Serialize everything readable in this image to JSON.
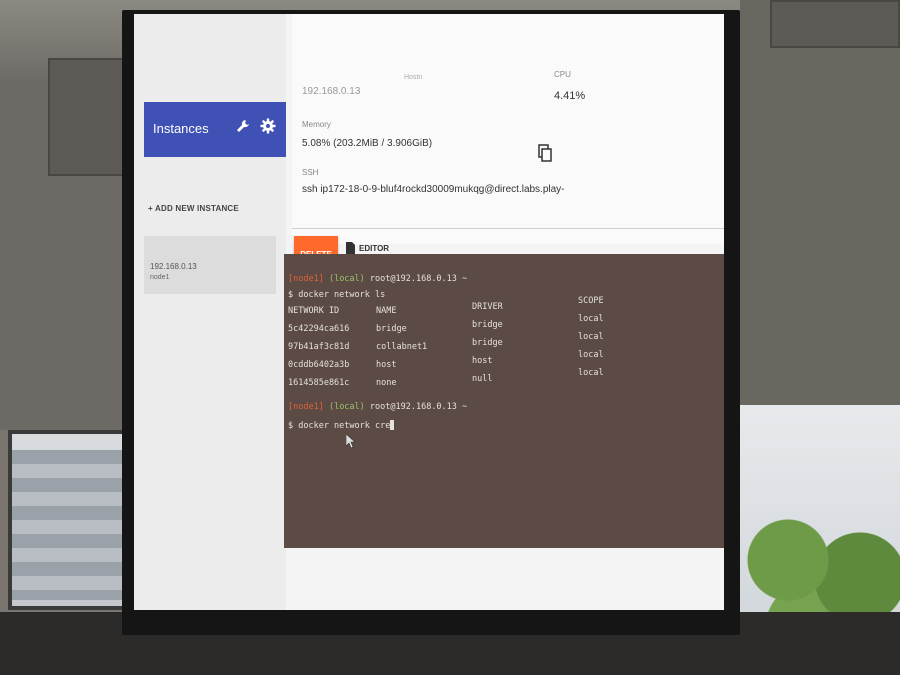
{
  "sidebar": {
    "title": "Instances",
    "add_instance": "+ ADD NEW INSTANCE",
    "instance": {
      "ip": "192.168.0.13",
      "name": "node1"
    }
  },
  "info": {
    "ip_top": "192.168.0.13",
    "hostname_label": "Hostn",
    "cpu_label": "CPU",
    "cpu_value": "4.41%",
    "memory_label": "Memory",
    "memory_value": "5.08% (203.2MiB / 3.906GiB)",
    "ssh_label": "SSH",
    "ssh_value": "ssh ip172-18-0-9-bluf4rockd30009mukqg@direct.labs.play-"
  },
  "actions": {
    "delete_label": "DELETE",
    "editor_label": "EDITOR"
  },
  "terminal": {
    "prompt_node": "[node1]",
    "prompt_local": "(local)",
    "prompt_host": "root@192.168.0.13 ~",
    "command1": "$ docker network ls",
    "headers": [
      "NETWORK ID",
      "NAME",
      "DRIVER",
      "SCOPE"
    ],
    "rows": [
      [
        "5c42294ca616",
        "bridge",
        "bridge",
        "local"
      ],
      [
        "97b41af3c81d",
        "collabnet1",
        "bridge",
        "local"
      ],
      [
        "0cddb6402a3b",
        "host",
        "host",
        "local"
      ],
      [
        "1614585e861c",
        "none",
        "null",
        "local"
      ]
    ],
    "command2": "$ docker network cre"
  },
  "colors": {
    "sidebar_header": "#3f51b5",
    "delete": "#ff6a2c",
    "terminal_bg": "#5b4b44",
    "prompt_node": "#e0603a",
    "prompt_local": "#9bc36a"
  }
}
